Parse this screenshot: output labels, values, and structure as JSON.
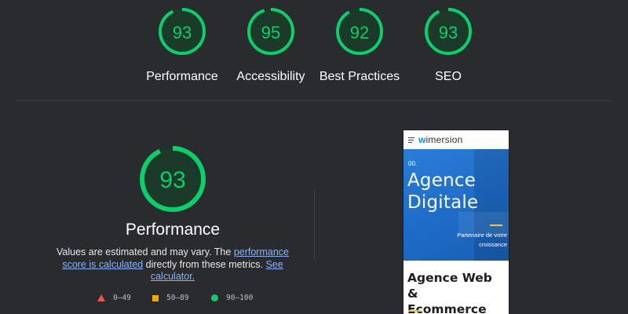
{
  "scores": [
    {
      "value": "93",
      "label": "Performance",
      "fraction": 0.93
    },
    {
      "value": "95",
      "label": "Accessibility",
      "fraction": 0.95
    },
    {
      "value": "92",
      "label": "Best Practices",
      "fraction": 0.92
    },
    {
      "value": "93",
      "label": "SEO",
      "fraction": 0.93
    }
  ],
  "performance": {
    "score": "93",
    "fraction": 0.93,
    "title": "Performance",
    "desc_1": "Values are estimated and may vary. The ",
    "link_1": "performance score is calculated",
    "desc_2": " directly from these metrics. ",
    "link_2": "See calculator."
  },
  "legend": {
    "fail": "0–49",
    "average": "50–89",
    "pass": "90–100"
  },
  "screenshot": {
    "logo_w": "w",
    "logo_text": "imersion",
    "hero_num": "00.",
    "hero_title_1": "Agence",
    "hero_title_2": "Digitale",
    "hero_sub_1": "Partenaire de votre",
    "hero_sub_2": "croissance",
    "section_title_1": "Agence Web &",
    "section_title_2": "Ecommerce"
  },
  "colors": {
    "pass": "#0cce6b",
    "pass_bg": "#1b3a2a",
    "average": "#ffa400",
    "fail": "#ff4e42",
    "link": "#8ab4f8"
  }
}
